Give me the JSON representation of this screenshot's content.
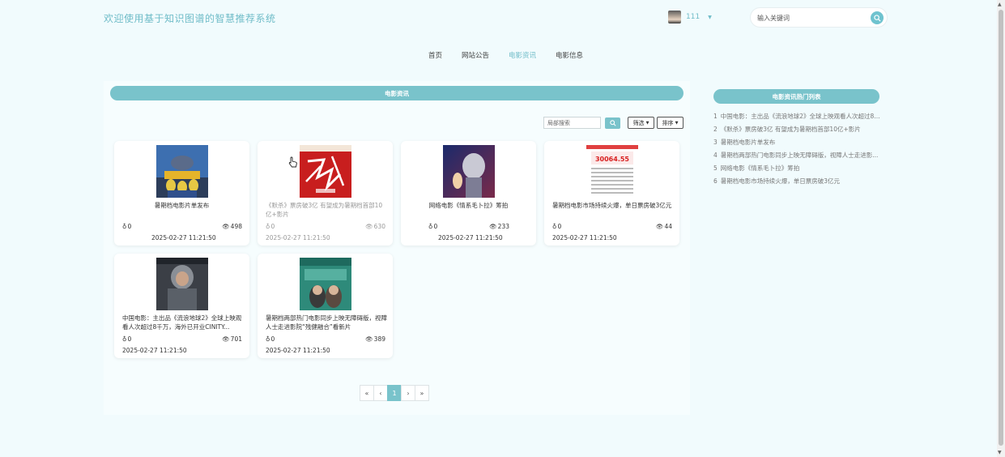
{
  "header": {
    "title": "欢迎使用基于知识图谱的智慧推荐系统",
    "user": {
      "name": "111"
    },
    "search": {
      "placeholder": "输入关键词"
    }
  },
  "nav": [
    {
      "label": "首页",
      "active": false
    },
    {
      "label": "网站公告",
      "active": false
    },
    {
      "label": "电影资讯",
      "active": true
    },
    {
      "label": "电影信息",
      "active": false
    }
  ],
  "main": {
    "section_title": "电影资讯",
    "toolbar": {
      "search_placeholder": "局部搜索",
      "filter_label": "筛选",
      "sort_label": "排序"
    },
    "cards": [
      {
        "title": "暑期档电影片单发布",
        "likes": "0",
        "views": "498",
        "date": "2025-02-27 11:21:50"
      },
      {
        "title": "《默杀》票房破3亿 有望成为暑期档首部10亿+影片",
        "likes": "0",
        "views": "630",
        "date": "2025-02-27 11:21:50"
      },
      {
        "title": "网络电影《情系毛卜拉》筹拍",
        "likes": "0",
        "views": "233",
        "date": "2025-02-27 11:21:50"
      },
      {
        "title": "暑期档电影市场持续火爆，单日票房破3亿元",
        "likes": "0",
        "views": "44",
        "date": "2025-02-27 11:21:50"
      },
      {
        "title": "中国电影：主出品《流浪地球2》全球上映观看人次超过8千万，海外已开业CINITY...",
        "likes": "0",
        "views": "701",
        "date": "2025-02-27 11:21:50"
      },
      {
        "title": "暑期档两部热门电影同步上映无障碍版，视障人士走进影院“残健融合”看新片",
        "likes": "0",
        "views": "389",
        "date": "2025-02-27 11:21:50"
      }
    ],
    "pagination": {
      "first": "«",
      "prev": "‹",
      "current": "1",
      "next": "›",
      "last": "»"
    }
  },
  "sidebar": {
    "title": "电影资讯热门列表",
    "items": [
      {
        "num": "1",
        "text": "中国电影：主出品《流浪地球2》全球上映观看人次超过8..."
      },
      {
        "num": "2",
        "text": "《默杀》票房破3亿 有望成为暑期档首部10亿+影片"
      },
      {
        "num": "3",
        "text": "暑期档电影片单发布"
      },
      {
        "num": "4",
        "text": "暑期档两部热门电影同步上映无障碍版，视障人士走进影..."
      },
      {
        "num": "5",
        "text": "网络电影《情系毛卜拉》筹拍"
      },
      {
        "num": "6",
        "text": "暑期档电影市场持续火爆，单日票房破3亿元"
      }
    ]
  },
  "poster_stamp_text": "30064.55",
  "colors": {
    "accent": "#79c3cb",
    "background": "#f1fbfd"
  }
}
